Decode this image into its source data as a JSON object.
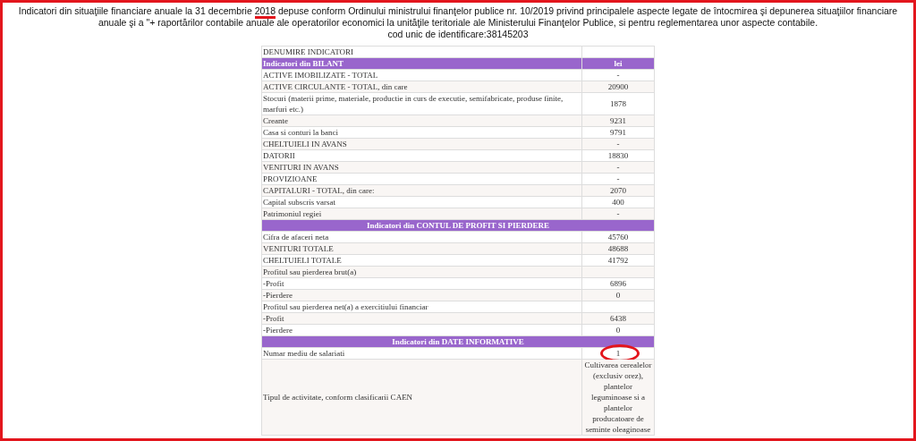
{
  "header": {
    "text_before": "Indicatori din situaţiile financiare anuale la 31 decembrie",
    "year": "2018",
    "year_marked": true,
    "text_after": "depuse conform Ordinului ministrului finanţelor publice nr. 10/2019 privind principalele aspecte legate de întocmirea şi depunerea situaţiilor financiare anuale şi a \"+ raportărilor contabile anuale ale operatorilor economici la unităţile teritoriale ale Ministerului Finanţelor Publice, si pentru reglementarea unor aspecte contabile.",
    "code": "cod unic de identificare:38145203"
  },
  "table": {
    "column_1": "DENUMIRE INDICATORI",
    "rows": [
      {
        "kind": "split_header",
        "label": "Indicatori din BILANT",
        "value": "lei"
      },
      {
        "kind": "row",
        "label": "ACTIVE IMOBILIZATE - TOTAL",
        "value": "-"
      },
      {
        "kind": "row",
        "label": "ACTIVE CIRCULANTE - TOTAL, din care",
        "value": "20900"
      },
      {
        "kind": "row",
        "label": "Stocuri (materii prime, materiale, productie in curs de executie, semifabricate, produse finite, marfuri etc.)",
        "value": "1878"
      },
      {
        "kind": "row",
        "label": "Creante",
        "value": "9231"
      },
      {
        "kind": "row",
        "label": "Casa si conturi la banci",
        "value": "9791"
      },
      {
        "kind": "row",
        "label": "CHELTUIELI IN AVANS",
        "value": "-"
      },
      {
        "kind": "row",
        "label": "DATORII",
        "value": "18830"
      },
      {
        "kind": "row",
        "label": "VENITURI IN AVANS",
        "value": "-"
      },
      {
        "kind": "row",
        "label": "PROVIZIOANE",
        "value": "-"
      },
      {
        "kind": "row",
        "label": "CAPITALURI - TOTAL, din care:",
        "value": "2070"
      },
      {
        "kind": "row",
        "label": "Capital subscris varsat",
        "value": "400"
      },
      {
        "kind": "row",
        "label": "Patrimoniul regiei",
        "value": "-"
      },
      {
        "kind": "span_header",
        "label": "Indicatori din CONTUL DE PROFIT SI PIERDERE"
      },
      {
        "kind": "row",
        "label": "Cifra de afaceri neta",
        "value": "45760"
      },
      {
        "kind": "row",
        "label": "VENITURI TOTALE",
        "value": "48688"
      },
      {
        "kind": "row",
        "label": "CHELTUIELI TOTALE",
        "value": "41792"
      },
      {
        "kind": "row",
        "label": "Profitul sau pierderea brut(a)"
      },
      {
        "kind": "row",
        "label": "-Profit",
        "value": "6896"
      },
      {
        "kind": "row",
        "label": "-Pierdere",
        "value": "0"
      },
      {
        "kind": "row",
        "label": "Profitul sau pierderea net(a) a exercitiului financiar"
      },
      {
        "kind": "row",
        "label": "-Profit",
        "value": "6438"
      },
      {
        "kind": "row",
        "label": "-Pierdere",
        "value": "0"
      },
      {
        "kind": "span_header",
        "label": "Indicatori din DATE INFORMATIVE"
      },
      {
        "kind": "row",
        "label": "Numar mediu de salariati",
        "value": "1",
        "circled": true
      },
      {
        "kind": "row",
        "label": "Tipul de activitate, conform clasificarii CAEN",
        "value": "Cultivarea cerealelor (exclusiv orez), plantelor leguminoase si a plantelor producatoare de seminte oleaginoase"
      }
    ]
  }
}
